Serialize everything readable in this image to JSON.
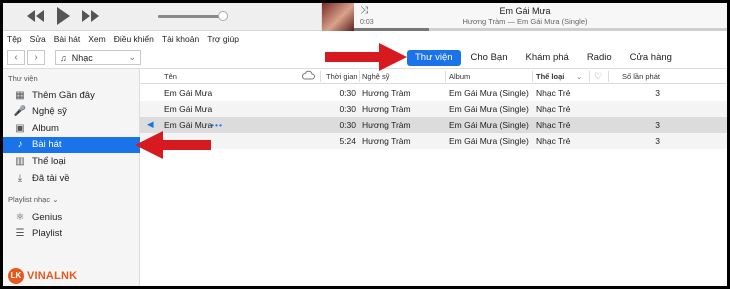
{
  "player": {
    "prev_icon": "rewind-icon",
    "play_icon": "play-icon",
    "next_icon": "fast-forward-icon",
    "volume_level": 0.93,
    "song_title": "Em Gái Mưa",
    "song_subtitle": "Hương Tràm — Em Gái Mưa (Single)",
    "elapsed": "0:03",
    "progress": 0.2
  },
  "menubar": {
    "items": [
      "Tệp",
      "Sửa",
      "Bài hát",
      "Xem",
      "Điều khiển",
      "Tài khoản",
      "Trợ giúp"
    ]
  },
  "toolbar": {
    "back": "‹",
    "forward": "›",
    "media_kind": "Nhạc",
    "tabs": [
      {
        "label": "Thư viện",
        "active": true
      },
      {
        "label": "Cho Bạn",
        "active": false
      },
      {
        "label": "Khám phá",
        "active": false
      },
      {
        "label": "Radio",
        "active": false
      },
      {
        "label": "Cửa hàng",
        "active": false
      }
    ]
  },
  "sidebar": {
    "library_header": "Thư viện",
    "items": [
      {
        "label": "Thêm Gần đây",
        "icon": "recently-added-icon"
      },
      {
        "label": "Nghệ sỹ",
        "icon": "artist-icon"
      },
      {
        "label": "Album",
        "icon": "album-icon"
      },
      {
        "label": "Bài hát",
        "icon": "song-note-icon",
        "selected": true
      },
      {
        "label": "Thể loại",
        "icon": "genre-icon"
      },
      {
        "label": "Đã tải về",
        "icon": "download-icon"
      }
    ],
    "playlist_header": "Playlist nhạc",
    "playlists": [
      {
        "label": "Genius",
        "icon": "genius-icon"
      },
      {
        "label": "Playlist",
        "icon": "playlist-icon"
      }
    ]
  },
  "table": {
    "headers": {
      "name": "Tên",
      "time": "Thời gian",
      "artist": "Nghệ sỹ",
      "album": "Album",
      "genre": "Thể loại",
      "plays": "Số lần phát"
    },
    "rows": [
      {
        "name": "Em Gái Mưa",
        "time": "0:30",
        "artist": "Hương Tràm",
        "album": "Em Gái Mưa (Single)",
        "genre": "Nhạc Trẻ",
        "plays": "3"
      },
      {
        "name": "Em Gái Mưa",
        "time": "0:30",
        "artist": "Hương Tràm",
        "album": "Em Gái Mưa (Single)",
        "genre": "Nhạc Trẻ",
        "plays": ""
      },
      {
        "name": "Em Gái Mưa",
        "time": "0:30",
        "artist": "Hương Tràm",
        "album": "Em Gái Mưa (Single)",
        "genre": "Nhạc Trẻ",
        "plays": "3",
        "playing": true
      },
      {
        "name": "",
        "time": "5:24",
        "artist": "Hương Tràm",
        "album": "Em Gái Mưa (Single)",
        "genre": "Nhạc Trẻ",
        "plays": "3"
      }
    ]
  },
  "watermark": {
    "mark": "LK",
    "text": "VINALNK"
  },
  "colors": {
    "accent": "#1a73e8",
    "arrow": "#d71920",
    "brand": "#e8581a"
  }
}
